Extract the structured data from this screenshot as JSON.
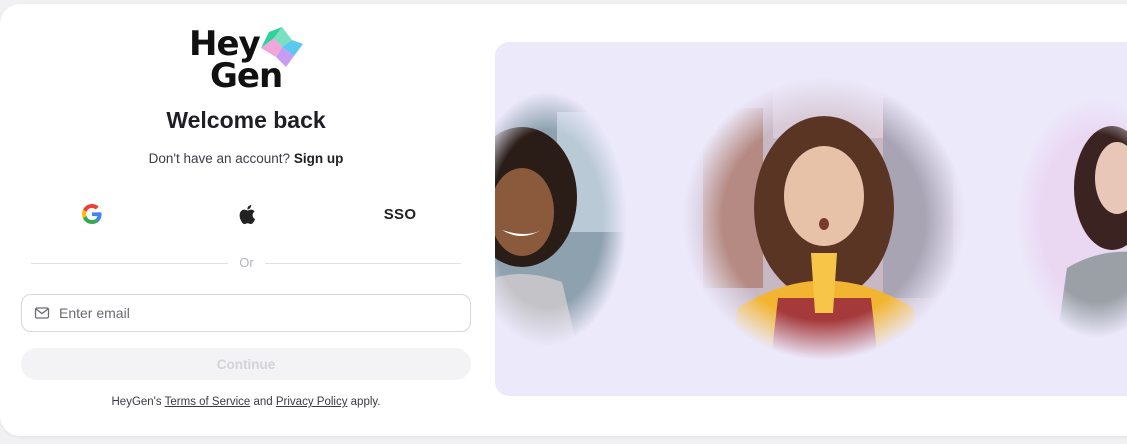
{
  "brand": {
    "line1": "Hey",
    "line2": "Gen"
  },
  "auth": {
    "title": "Welcome back",
    "signup_prompt": "Don't have an account?",
    "signup_link": "Sign up",
    "sso_label": "SSO",
    "divider_text": "Or",
    "email_placeholder": "Enter email",
    "email_value": "",
    "continue_label": "Continue",
    "legal": {
      "prefix": "HeyGen's",
      "terms": "Terms of Service",
      "and": "and",
      "privacy": "Privacy Policy",
      "suffix": "apply."
    }
  },
  "icons": {
    "google": "google-icon",
    "apple": "apple-icon",
    "email": "mail-icon"
  },
  "colors": {
    "hero_background": "#ece9fb",
    "continue_disabled_bg": "#f3f3f5",
    "continue_disabled_text": "#d3d3d8"
  }
}
